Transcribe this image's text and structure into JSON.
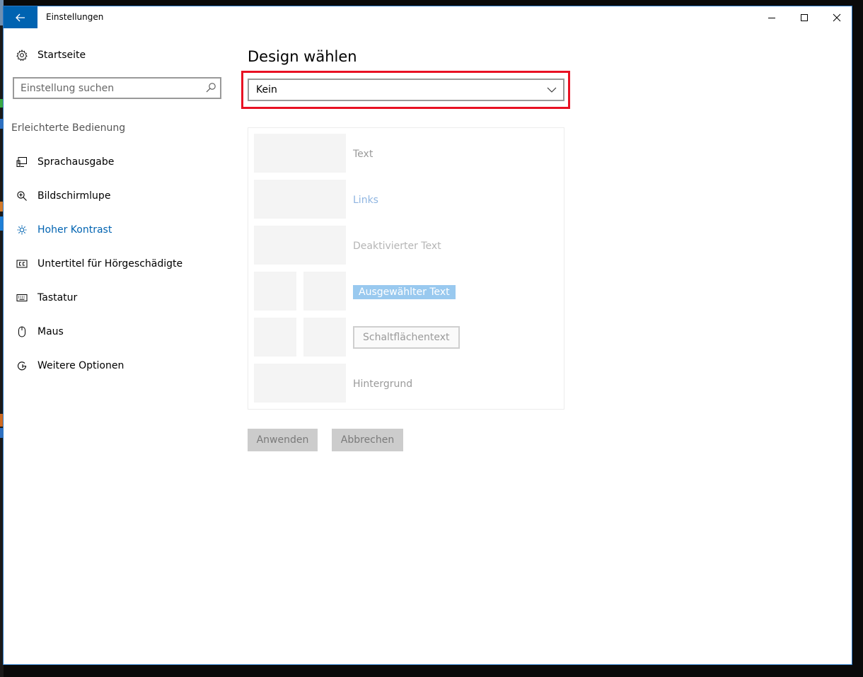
{
  "window": {
    "title": "Einstellungen",
    "accent": "#0063b1"
  },
  "sidebar": {
    "home_label": "Startseite",
    "search_placeholder": "Einstellung suchen",
    "section_label": "Erleichterte Bedienung",
    "items": [
      {
        "label": "Sprachausgabe",
        "icon": "narrator-icon"
      },
      {
        "label": "Bildschirmlupe",
        "icon": "magnifier-icon"
      },
      {
        "label": "Hoher Kontrast",
        "icon": "brightness-icon",
        "active": true
      },
      {
        "label": "Untertitel für Hörgeschädigte",
        "icon": "closed-captions-icon"
      },
      {
        "label": "Tastatur",
        "icon": "keyboard-icon"
      },
      {
        "label": "Maus",
        "icon": "mouse-icon"
      },
      {
        "label": "Weitere Optionen",
        "icon": "more-options-icon"
      }
    ]
  },
  "main": {
    "title": "Design wählen",
    "theme_dropdown": {
      "selected": "Kein"
    },
    "preview": {
      "text": "Text",
      "links": "Links",
      "disabled_text": "Deaktivierter Text",
      "selected_text": "Ausgewählter Text",
      "button_text": "Schaltflächentext",
      "background": "Hintergrund"
    },
    "apply_label": "Anwenden",
    "cancel_label": "Abbrechen"
  },
  "colors": {
    "highlight_frame": "#e81123",
    "selected_text_bg": "#99c9ef",
    "link_text": "#8fb5e1"
  }
}
